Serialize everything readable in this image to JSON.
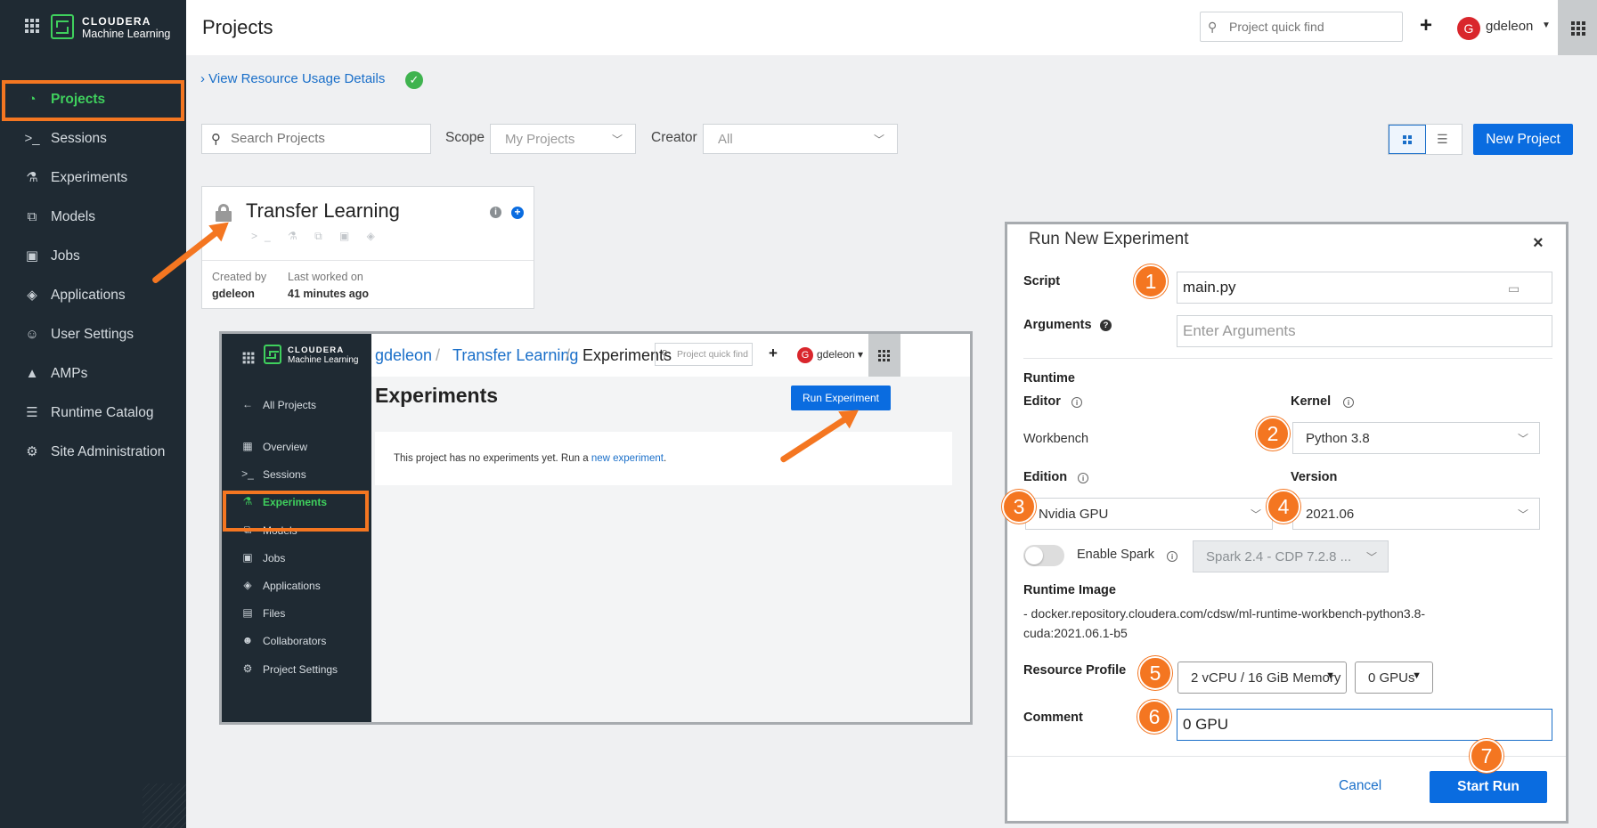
{
  "brand": {
    "line1": "CLOUDERA",
    "line2": "Machine Learning"
  },
  "sidebar": {
    "items": [
      {
        "label": "Projects",
        "icon": "gauge-icon",
        "active": true
      },
      {
        "label": "Sessions",
        "icon": "terminal-icon"
      },
      {
        "label": "Experiments",
        "icon": "flask-icon"
      },
      {
        "label": "Models",
        "icon": "model-graph-icon"
      },
      {
        "label": "Jobs",
        "icon": "jobs-icon"
      },
      {
        "label": "Applications",
        "icon": "layers-icon"
      },
      {
        "label": "User Settings",
        "icon": "user-icon"
      },
      {
        "label": "AMPs",
        "icon": "amps-icon"
      },
      {
        "label": "Runtime Catalog",
        "icon": "list-icon"
      },
      {
        "label": "Site Administration",
        "icon": "gear-icon"
      }
    ]
  },
  "header": {
    "title": "Projects",
    "quickfind_placeholder": "Project quick find",
    "plus": "+",
    "avatar_letter": "G",
    "user": "gdeleon"
  },
  "content": {
    "resource_link": "View Resource Usage Details",
    "search_placeholder": "Search Projects",
    "scope_label": "Scope",
    "scope_value": "My Projects",
    "creator_label": "Creator",
    "creator_value": "All",
    "new_project": "New Project"
  },
  "project_card": {
    "title": "Transfer Learning",
    "created_by_label": "Created by",
    "created_by": "gdeleon",
    "last_worked_label": "Last worked on",
    "last_worked": "41 minutes ago"
  },
  "inset": {
    "breadcrumb": [
      "gdeleon",
      "Transfer Learning",
      "Experiments"
    ],
    "quickfind_placeholder": "Project quick find",
    "user": "gdeleon",
    "avatar_letter": "G",
    "all_projects": "All Projects",
    "nav": [
      "Overview",
      "Sessions",
      "Experiments",
      "Models",
      "Jobs",
      "Applications",
      "Files",
      "Collaborators",
      "Project Settings"
    ],
    "heading": "Experiments",
    "run_button": "Run Experiment",
    "empty_text": "This project has no experiments yet. Run a ",
    "empty_link": "new experiment",
    "empty_end": "."
  },
  "modal": {
    "title": "Run New Experiment",
    "close": "×",
    "script_label": "Script",
    "script_value": "main.py",
    "arguments_label": "Arguments",
    "arguments_placeholder": "Enter Arguments",
    "runtime_label": "Runtime",
    "editor_label": "Editor",
    "editor_value": "Workbench",
    "kernel_label": "Kernel",
    "kernel_value": "Python 3.8",
    "edition_label": "Edition",
    "edition_value": "Nvidia GPU",
    "version_label": "Version",
    "version_value": "2021.06",
    "spark_label": "Enable Spark",
    "spark_value": "Spark 2.4 - CDP 7.2.8 ...",
    "runtime_image_label": "Runtime Image",
    "runtime_image_line1": "- docker.repository.cloudera.com/cdsw/ml-runtime-workbench-python3.8-",
    "runtime_image_line2": "cuda:2021.06.1-b5",
    "resource_profile_label": "Resource Profile",
    "resource_profile_value": "2 vCPU / 16 GiB Memory",
    "gpus_value": "0 GPUs",
    "comment_label": "Comment",
    "comment_value": "0 GPU",
    "cancel": "Cancel",
    "start_run": "Start Run"
  },
  "badges": [
    "1",
    "2",
    "3",
    "4",
    "5",
    "6",
    "7"
  ],
  "colors": {
    "accent": "#f47621",
    "primary": "#0a6ce0",
    "brand_green": "#3fd05d",
    "sidebar": "#1f2a33"
  }
}
